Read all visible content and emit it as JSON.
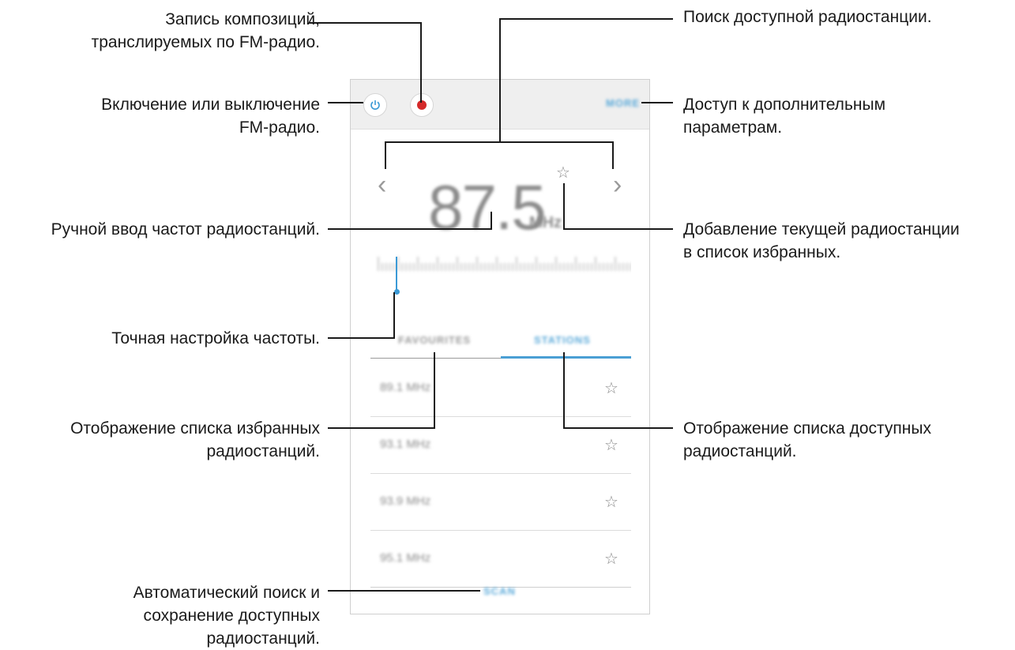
{
  "callouts": {
    "record": [
      "Запись композиций,",
      "транслируемых по FM-радио."
    ],
    "power": [
      "Включение или выключение",
      "FM-радио."
    ],
    "manual_freq": [
      "Ручной ввод частот радиостанций."
    ],
    "fine_tune": [
      "Точная настройка частоты."
    ],
    "favourites_list": [
      "Отображение списка избранных",
      "радиостанций."
    ],
    "scan": [
      "Автоматический поиск и",
      "сохранение доступных",
      "радиостанций."
    ],
    "search": [
      "Поиск доступной радиостанции."
    ],
    "more": [
      "Доступ к дополнительным",
      "параметрам."
    ],
    "add_favourite": [
      "Добавление текущей радиостанции",
      "в список избранных."
    ],
    "stations_list": [
      "Отображение списка доступных",
      "радиостанций."
    ]
  },
  "app": {
    "more_label": "MORE",
    "frequency": "87.5",
    "frequency_unit": "MHz",
    "tabs": [
      "FAVOURITES",
      "STATIONS"
    ],
    "stations": [
      "89.1 MHz",
      "93.1 MHz",
      "93.9 MHz",
      "95.1 MHz"
    ],
    "scan_label": "SCAN",
    "accent_color": "#4a9fd4",
    "record_color": "#d42a2a",
    "icons": [
      "power-icon",
      "record-icon",
      "chevron-left-icon",
      "chevron-right-icon",
      "star-icon",
      "tuner-knob-icon"
    ]
  }
}
